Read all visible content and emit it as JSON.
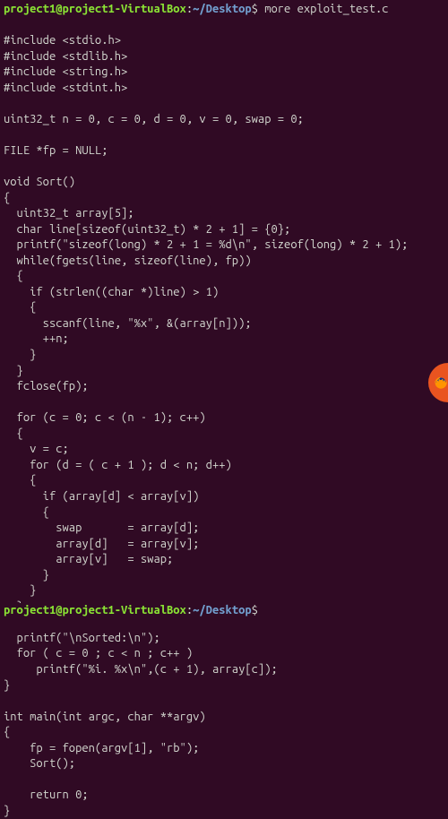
{
  "prompt": {
    "user_host": "project1@project1-VirtualBox",
    "separator": ":",
    "path": "~/Desktop",
    "dollar": "$",
    "command": "more exploit_test.c"
  },
  "code": {
    "l01": "#include <stdio.h>",
    "l02": "#include <stdlib.h>",
    "l03": "#include <string.h>",
    "l04": "#include <stdint.h>",
    "l05": "",
    "l06": "uint32_t n = 0, c = 0, d = 0, v = 0, swap = 0;",
    "l07": "",
    "l08": "FILE *fp = NULL;",
    "l09": "",
    "l10": "void Sort()",
    "l11": "{",
    "l12": "  uint32_t array[5];",
    "l13": "  char line[sizeof(uint32_t) * 2 + 1] = {0};",
    "l14": "  printf(\"sizeof(long) * 2 + 1 = %d\\n\", sizeof(long) * 2 + 1);",
    "l15": "  while(fgets(line, sizeof(line), fp))",
    "l16": "  {",
    "l17": "    if (strlen((char *)line) > 1)",
    "l18": "    {",
    "l19": "      sscanf(line, \"%x\", &(array[n]));",
    "l20": "      ++n;",
    "l21": "    }",
    "l22": "  }",
    "l23": "  fclose(fp);",
    "l24": "",
    "l25": "  for (c = 0; c < (n - 1); c++)",
    "l26": "  {",
    "l27": "    v = c;",
    "l28": "    for (d = ( c + 1 ); d < n; d++)",
    "l29": "    {",
    "l30": "      if (array[d] < array[v])",
    "l31": "      {",
    "l32": "        swap       = array[d];",
    "l33": "        array[d]   = array[v];",
    "l34": "        array[v]   = swap;",
    "l35": "      }",
    "l36": "    }",
    "l37": "  }",
    "l38": "",
    "l39": "  printf(\"\\nSorted:\\n\");",
    "l40": "  for ( c = 0 ; c < n ; c++ )",
    "l41": "     printf(\"%i. %x\\n\",(c + 1), array[c]);",
    "l42": "}",
    "l43": "",
    "l44": "int main(int argc, char **argv)",
    "l45": "{",
    "l46": "    fp = fopen(argv[1], \"rb\");",
    "l47": "    Sort();",
    "l48": "",
    "l49": "    return 0;",
    "l50": "}"
  },
  "bottom": {
    "user_host": "project1@project1-VirtualBox",
    "separator": ":",
    "path": "~/Desktop",
    "dollar": "$",
    "cursor": " "
  },
  "colors": {
    "background": "#300a24",
    "text": "#d3d7cf",
    "promptUser": "#8ae234",
    "promptPath": "#729fcf",
    "accent": "#e95420"
  }
}
